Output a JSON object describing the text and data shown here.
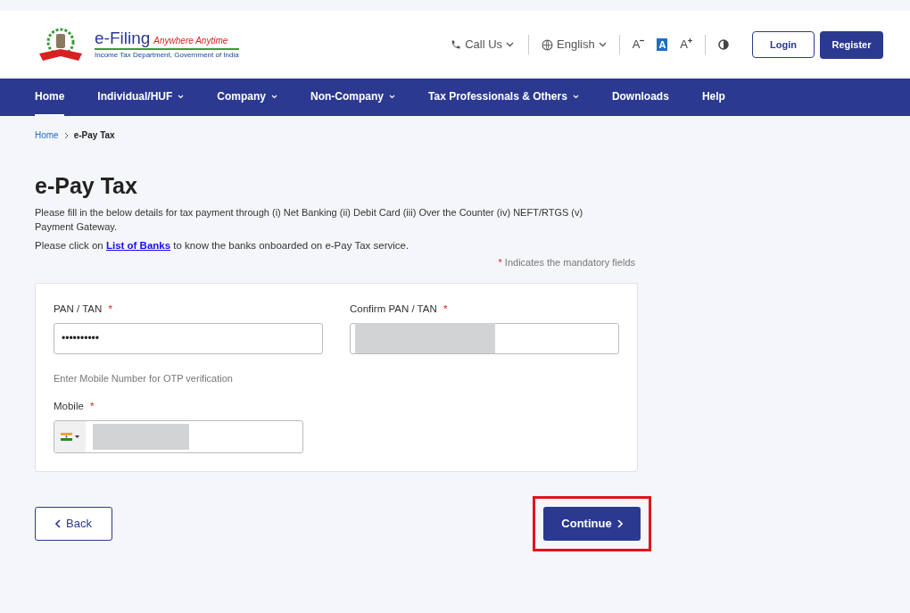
{
  "header": {
    "logo": {
      "title": "e-Filing",
      "tagline": "Anywhere Anytime",
      "subtitle": "Income Tax Department, Government of India"
    },
    "call_us": "Call Us",
    "language": "English",
    "text_size": [
      {
        "kind": "decrease",
        "label": "A",
        "selected": false
      },
      {
        "kind": "normal",
        "label": "A",
        "selected": true
      },
      {
        "kind": "increase",
        "label": "A",
        "selected": false
      }
    ],
    "login": "Login",
    "register": "Register"
  },
  "nav": [
    {
      "label": "Home",
      "selected": true,
      "dropdown": false
    },
    {
      "label": "Individual/HUF",
      "selected": false,
      "dropdown": true
    },
    {
      "label": "Company",
      "selected": false,
      "dropdown": true
    },
    {
      "label": "Non-Company",
      "selected": false,
      "dropdown": true
    },
    {
      "label": "Tax Professionals & Others",
      "selected": false,
      "dropdown": true
    },
    {
      "label": "Downloads",
      "selected": false,
      "dropdown": false
    },
    {
      "label": "Help",
      "selected": false,
      "dropdown": false
    }
  ],
  "breadcrumb": [
    "Home",
    "e-Pay Tax"
  ],
  "title": "e-Pay Tax",
  "intro": "Please fill in the below details for tax payment through (i) Net Banking (ii) Debit Card (iii) Over the Counter (iv) NEFT/RTGS (v) Payment Gateway.",
  "banks_note": {
    "before": "Please click on",
    "link": "List of Banks",
    "after": "to know the banks onboarded on e-Pay Tax service."
  },
  "mandatory_note": {
    "mark": "*",
    "text": "Indicates the mandatory fields"
  },
  "form": {
    "pan": {
      "label": "PAN / TAN",
      "required": true,
      "value": "••••••••••"
    },
    "confirm_pan": {
      "label": "Confirm PAN / TAN",
      "required": true,
      "redacted": true
    },
    "otp_hint": "Enter Mobile Number for OTP verification",
    "mobile": {
      "label": "Mobile",
      "required": true,
      "redacted": true
    }
  },
  "buttons": {
    "back": "Back",
    "continue": "Continue",
    "continue_highlighted": true
  }
}
